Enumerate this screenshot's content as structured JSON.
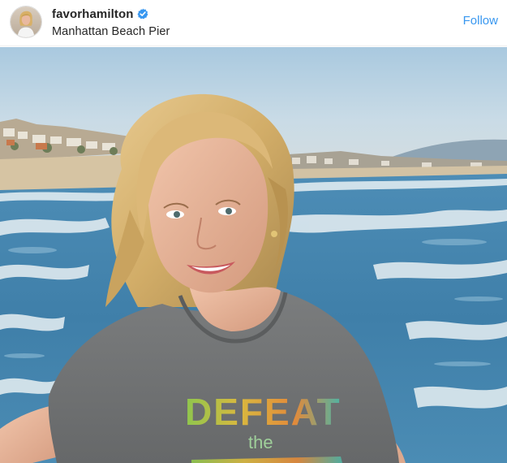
{
  "post": {
    "username": "favorhamilton",
    "verified": true,
    "location": "Manhattan Beach Pier",
    "follow_label": "Follow"
  },
  "icons": {
    "verified": "verified-badge-icon"
  },
  "colors": {
    "follow_blue": "#3897f0",
    "verified_blue": "#3897f0",
    "text_primary": "#262626"
  },
  "photo": {
    "shirt_text_line1": "DEFEAT",
    "shirt_text_line2": "the"
  }
}
